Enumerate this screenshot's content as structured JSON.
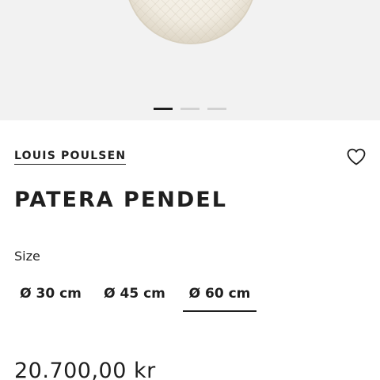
{
  "carousel": {
    "slides_total": 3,
    "active_slide": 1
  },
  "product": {
    "brand": "LOUIS POULSEN",
    "title": "PATERA PENDEL",
    "size_label": "Size",
    "sizes": [
      "Ø 30 cm",
      "Ø 45 cm",
      "Ø 60 cm"
    ],
    "selected_size": "Ø 60 cm",
    "price": "20.700,00 kr"
  },
  "colors": {
    "hero_bg": "#f2f2f2",
    "text": "#1f1f1f",
    "dot_inactive": "#d2d2d2"
  },
  "icons": {
    "favorite": "heart-outline-icon"
  }
}
